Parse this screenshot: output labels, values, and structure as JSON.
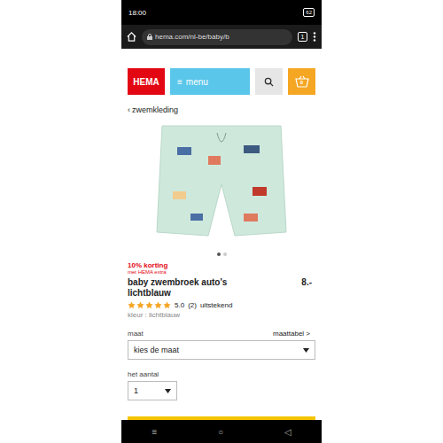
{
  "status_bar": {
    "time": "18:00",
    "battery": "62"
  },
  "browser": {
    "url": "hema.com/nl-be/baby/b",
    "tab_count": "1"
  },
  "header": {
    "logo": "HEMA",
    "menu_icon": "≡",
    "menu": "menu",
    "cart_count": "0"
  },
  "breadcrumb": {
    "icon": "‹",
    "label": "zwemkleding"
  },
  "carousel": {
    "dots": [
      {
        "selected": true
      },
      {
        "selected": false
      }
    ]
  },
  "promo": {
    "discount": "10% korting",
    "note": "met HEMA extra"
  },
  "product": {
    "title": "baby zwembroek auto's lichtblauw",
    "price": "8.-",
    "stars": 5,
    "rating": "5.0",
    "reviews": "(2)",
    "verdict": "uitstekend",
    "color_label": "kleur : lichtblauw"
  },
  "size": {
    "label": "maat",
    "chart_link": "maattabel >",
    "placeholder": "kies de maat"
  },
  "quantity": {
    "label": "het aantal",
    "value": "1"
  },
  "nav_bar": {
    "buttons": [
      "≡",
      "○",
      "◁"
    ]
  }
}
